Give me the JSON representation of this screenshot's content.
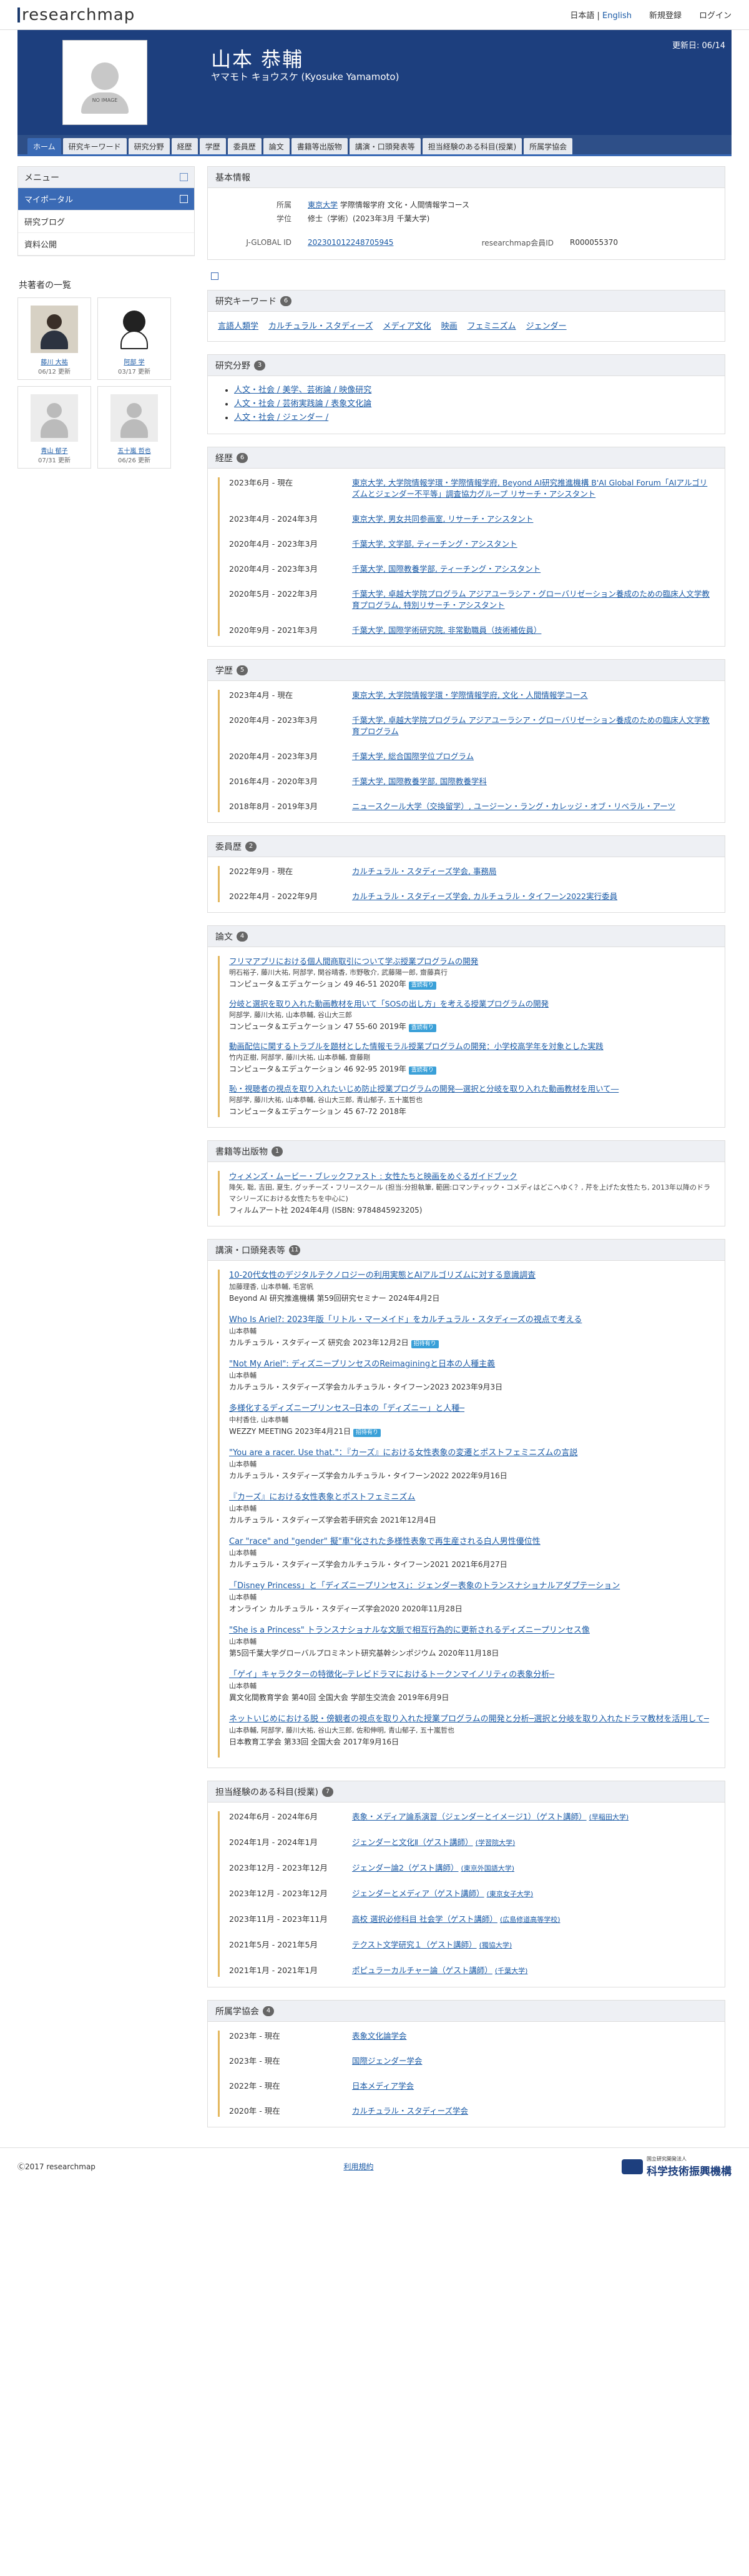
{
  "header": {
    "logo": "researchmap",
    "lang_ja": "日本語",
    "lang_sep": " | ",
    "lang_en": "English",
    "register": "新規登録",
    "login": "ログイン"
  },
  "profile": {
    "no_image": "NO IMAGE",
    "name": "山本 恭輔",
    "kana": "ヤマモト キョウスケ  (Kyosuke Yamamoto)",
    "updated": "更新日: 06/14"
  },
  "tabs": [
    "ホーム",
    "研究キーワード",
    "研究分野",
    "経歴",
    "学歴",
    "委員歴",
    "論文",
    "書籍等出版物",
    "講演・口頭発表等",
    "担当経験のある科目(授業)",
    "所属学協会"
  ],
  "sidebar": {
    "menu_title": "メニュー",
    "items": [
      "マイポータル",
      "研究ブログ",
      "資料公開"
    ],
    "coauthors_title": "共著者の一覧",
    "coauthors": [
      {
        "name": "藤川 大祐",
        "date": "06/12 更新"
      },
      {
        "name": "阿部 学",
        "date": "03/17 更新"
      },
      {
        "name": "",
        "date": ""
      },
      {
        "name": "青山 郁子",
        "date": "07/31 更新"
      },
      {
        "name": "五十嵐 哲也",
        "date": "06/26 更新"
      },
      {
        "name": "",
        "date": ""
      }
    ]
  },
  "basic": {
    "title": "基本情報",
    "affil_label": "所属",
    "affil_link": "東京大学",
    "affil_rest": " 学際情報学府 文化・人間情報学コース",
    "degree_label": "学位",
    "degree": "修士（学術）(2023年3月 千葉大学)",
    "jglobal_label": "J-GLOBAL ID",
    "jglobal": "202301012248705945",
    "rmap_label": "researchmap会員ID",
    "rmap": "R000055370"
  },
  "keywords": {
    "title": "研究キーワード",
    "count": "6",
    "items": [
      "言語人類学",
      "カルチュラル・スタディーズ",
      "メディア文化",
      "映画",
      "フェミニズム",
      "ジェンダー"
    ]
  },
  "fields": {
    "title": "研究分野",
    "count": "3",
    "items": [
      "人文・社会 / 美学、芸術論 / 映像研究",
      "人文・社会 / 芸術実践論 / 表象文化論",
      "人文・社会 / ジェンダー /"
    ]
  },
  "career": {
    "title": "経歴",
    "count": "6",
    "items": [
      {
        "date": "2023年6月 - 現在",
        "desc": "東京大学, 大学院情報学環・学際情報学府, Beyond AI研究推進機構 B'AI Global Forum「AIアルゴリズムとジェンダー不平等」調査協力グループ リサーチ・アシスタント"
      },
      {
        "date": "2023年4月 - 2024年3月",
        "desc": "東京大学, 男女共同参画室, リサーチ・アシスタント"
      },
      {
        "date": "2020年4月 - 2023年3月",
        "desc": "千葉大学, 文学部, ティーチング・アシスタント"
      },
      {
        "date": "2020年4月 - 2023年3月",
        "desc": "千葉大学, 国際教養学部, ティーチング・アシスタント"
      },
      {
        "date": "2020年5月 - 2022年3月",
        "desc": "千葉大学, 卓越大学院プログラム アジアユーラシア・グローバリゼーション養成のための臨床人文学教育プログラム, 特別リサーチ・アシスタント"
      },
      {
        "date": "2020年9月 - 2021年3月",
        "desc": "千葉大学, 国際学術研究院, 非常勤職員（技術補佐員）"
      }
    ]
  },
  "education": {
    "title": "学歴",
    "count": "5",
    "items": [
      {
        "date": "2023年4月 - 現在",
        "desc": "東京大学, 大学院情報学環・学際情報学府, 文化・人間情報学コース"
      },
      {
        "date": "2020年4月 - 2023年3月",
        "desc": "千葉大学, 卓越大学院プログラム アジアユーラシア・グローバリゼーション養成のための臨床人文学教育プログラム"
      },
      {
        "date": "2020年4月 - 2023年3月",
        "desc": "千葉大学, 総合国際学位プログラム"
      },
      {
        "date": "2016年4月 - 2020年3月",
        "desc": "千葉大学, 国際教養学部, 国際教養学科"
      },
      {
        "date": "2018年8月 - 2019年3月",
        "desc": "ニュースクール大学（交換留学）, ユージーン・ラング・カレッジ・オブ・リベラル・アーツ"
      }
    ]
  },
  "committee": {
    "title": "委員歴",
    "count": "2",
    "items": [
      {
        "date": "2022年9月 - 現在",
        "desc": "カルチュラル・スタディーズ学会, 事務局"
      },
      {
        "date": "2022年4月 - 2022年9月",
        "desc": "カルチュラル・スタディーズ学会, カルチュラル・タイフーン2022実行委員"
      }
    ]
  },
  "papers": {
    "title": "論文",
    "count": "4",
    "items": [
      {
        "title": "フリマアプリにおける個人間商取引について学ぶ授業プログラムの開発",
        "authors": "明石裕子, 藤川大祐, 阿部学, 関谷晴香, 市野敬介, 武藤陽一郎, 齋藤真行",
        "src": "コンピュータ＆エデュケーション 49 46-51 2020年",
        "tag": "査読有り"
      },
      {
        "title": "分岐と選択を取り入れた動画教材を用いて「SOSの出し方」を考える授業プログラムの開発",
        "authors": "阿部学, 藤川大祐, 山本恭輔, 谷山大三郎",
        "src": "コンピュータ＆エデュケーション 47 55-60 2019年",
        "tag": "査読有り"
      },
      {
        "title": "動画配信に関するトラブルを題材とした情報モラル授業プログラムの開発：小学校高学年を対象とした実践",
        "authors": "竹内正樹, 阿部学, 藤川大祐, 山本恭輔, 齋藤剛",
        "src": "コンピュータ＆エデュケーション 46 92-95 2019年",
        "tag": "査読有り"
      },
      {
        "title": "恥・視聴者の視点を取り入れたいじめ防止授業プログラムの開発―選択と分岐を取り入れた動画教材を用いて―",
        "authors": "阿部学, 藤川大祐, 山本恭輔, 谷山大三郎, 青山郁子, 五十嵐哲也",
        "src": "コンピュータ＆エデュケーション 45 67-72 2018年",
        "tag": ""
      }
    ]
  },
  "books": {
    "title": "書籍等出版物",
    "count": "1",
    "items": [
      {
        "title": "ウィメンズ・ムービー・ブレックファスト : 女性たちと映画をめぐるガイドブック",
        "authors": "降矢, 聡, 吉田, 夏生, グッチーズ・フリースクール (担当:分担執筆, 範囲:ロマンティック・コメディはどこへゆく？, 芹を上げた女性たち, 2013年以降のドラマシリーズにおける女性たちを中心に)",
        "src": "フィルムアート社 2024年4月 (ISBN: 9784845923205)",
        "tag": ""
      }
    ]
  },
  "presentations": {
    "title": "講演・口頭発表等",
    "count": "11",
    "items": [
      {
        "title": "10-20代女性のデジタルテクノロジーの利用実態とAIアルゴリズムに対する意識調査",
        "authors": "加藤理香, 山本恭輔, 毛宮帆",
        "src": "Beyond AI 研究推進機構 第59回研究セミナー 2024年4月2日",
        "tag": ""
      },
      {
        "title": "Who Is Ariel?: 2023年版「リトル・マーメイド」をカルチュラル・スタディーズの視点で考える",
        "authors": "山本恭輔",
        "src": "カルチュラル・スタディーズ 研究会 2023年12月2日",
        "tag": "招待有り"
      },
      {
        "title": "\"Not My Ariel\": ディズニープリンセスのReimaginingと日本の人種主義",
        "authors": "山本恭輔",
        "src": "カルチュラル・スタディーズ学会カルチュラル・タイフーン2023 2023年9月3日",
        "tag": ""
      },
      {
        "title": "多様化するディズニープリンセス─日本の「ディズニー」と人種─",
        "authors": "中村香住, 山本恭輔",
        "src": "WEZZY MEETING 2023年4月21日",
        "tag": "招待有り"
      },
      {
        "title": "\"You are a racer. Use that.\"：『カーズ』における女性表象の変遷とポストフェミニズムの言説",
        "authors": "山本恭輔",
        "src": "カルチュラル・スタディーズ学会カルチュラル・タイフーン2022 2022年9月16日",
        "tag": ""
      },
      {
        "title": "『カーズ』における女性表象とポストフェミニズム",
        "authors": "山本恭輔",
        "src": "カルチュラル・スタディーズ学会若手研究会 2021年12月4日",
        "tag": ""
      },
      {
        "title": "Car \"race\" and \"gender\" 擬\"車\"化された多様性表象で再生産される白人男性優位性",
        "authors": "山本恭輔",
        "src": "カルチュラル・スタディーズ学会カルチュラル・タイフーン2021 2021年6月27日",
        "tag": ""
      },
      {
        "title": "「Disney Princess」と「ディズニープリンセス」：ジェンダー表象のトランスナショナルアダプテーション",
        "authors": "山本恭輔",
        "src": "オンライン カルチュラル・スタディーズ学会2020 2020年11月28日",
        "tag": ""
      },
      {
        "title": "\"She is a Princess\" トランスナショナルな文脈で相互行為的に更新されるディズニープリンセス像",
        "authors": "山本恭輔",
        "src": "第5回千葉大学グローバルプロミネント研究基幹シンポジウム 2020年11月18日",
        "tag": ""
      },
      {
        "title": "「ゲイ」キャラクターの特徴化─テレビドラマにおけるトークンマイノリティの表象分析─",
        "authors": "山本恭輔",
        "src": "異文化間教育学会 第40回 全国大会 学部生交流会 2019年6月9日",
        "tag": ""
      },
      {
        "title": "ネットいじめにおける脱・傍観者の視点を取り入れた授業プログラムの開発と分析─選択と分岐を取り入れたドラマ教材を活用して─",
        "authors": "山本恭輔, 阿部学, 藤川大祐, 谷山大三郎, 佐和伸明, 青山郁子, 五十嵐哲也",
        "src": "日本教育工学会 第33回 全国大会 2017年9月16日",
        "tag": ""
      }
    ]
  },
  "courses": {
    "title": "担当経験のある科目(授業)",
    "count": "7",
    "items": [
      {
        "date": "2024年6月 - 2024年6月",
        "desc": "表象・メディア論系演習（ジェンダーとイメージ1）（ゲスト講師）",
        "org": "(早稲田大学)"
      },
      {
        "date": "2024年1月 - 2024年1月",
        "desc": "ジェンダーと文化Ⅱ（ゲスト講師）",
        "org": "(学習院大学)"
      },
      {
        "date": "2023年12月 - 2023年12月",
        "desc": "ジェンダー論2（ゲスト講師）",
        "org": "(東京外国語大学)"
      },
      {
        "date": "2023年12月 - 2023年12月",
        "desc": "ジェンダーとメディア（ゲスト講師）",
        "org": "(東京女子大学)"
      },
      {
        "date": "2023年11月 - 2023年11月",
        "desc": "高校 選択必修科目 社会学（ゲスト講師）",
        "org": "(広島修道高等学校)"
      },
      {
        "date": "2021年5月 - 2021年5月",
        "desc": "テクスト文学研究１（ゲスト講師）",
        "org": "(獨協大学)"
      },
      {
        "date": "2021年1月 - 2021年1月",
        "desc": "ポピュラーカルチャー論（ゲスト講師）",
        "org": "(千葉大学)"
      }
    ]
  },
  "societies": {
    "title": "所属学協会",
    "count": "4",
    "items": [
      {
        "date": "2023年 - 現在",
        "desc": "表象文化論学会"
      },
      {
        "date": "2023年 - 現在",
        "desc": "国際ジェンダー学会"
      },
      {
        "date": "2022年 - 現在",
        "desc": "日本メディア学会"
      },
      {
        "date": "2020年 - 現在",
        "desc": "カルチュラル・スタディーズ学会"
      }
    ]
  },
  "footer": {
    "copyright": "Ⓒ2017 researchmap",
    "terms": "利用規約",
    "jst_small": "国立研究開発法人",
    "jst_big": "科学技術振興機構"
  }
}
